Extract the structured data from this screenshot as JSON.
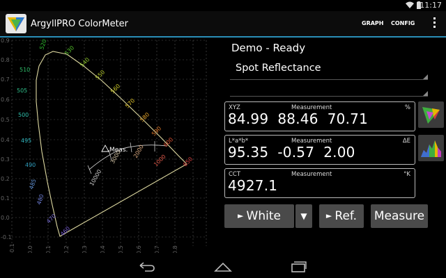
{
  "status_bar": {
    "time": "11:17"
  },
  "action_bar": {
    "title": "ArgyllPRO ColorMeter",
    "graph_label": "GRAPH",
    "config_label": "CONFIG"
  },
  "chart": {
    "x_ticks": [
      "-0.1",
      "0.0",
      "0.1",
      "0.2",
      "0.3",
      "0.4",
      "0.5",
      "0.6",
      "0.7",
      "0.8"
    ],
    "y_ticks": [
      "0.9",
      "0.8",
      "0.7",
      "0.6",
      "0.5",
      "0.4",
      "0.3",
      "0.2",
      "0.1",
      "0.0",
      "-0.1"
    ],
    "wavelength_labels": [
      "520",
      "530",
      "540",
      "550",
      "560",
      "570",
      "580",
      "590",
      "600",
      "650",
      "510",
      "505",
      "500",
      "495",
      "490",
      "485",
      "480",
      "470",
      "460"
    ],
    "cct_labels": [
      "10000",
      "3000",
      "2000",
      "1000"
    ],
    "marker_label": "Meas."
  },
  "status": "Demo - Ready",
  "mode": "Spot Reflectance",
  "xyz": {
    "label": "XYZ",
    "measurement": "Measurement",
    "unit": "%",
    "values": "84.99  88.46  70.71"
  },
  "lab": {
    "label": "L*a*b*",
    "measurement": "Measurement",
    "unit": "ΔE",
    "values": "95.35  -0.57  2.00"
  },
  "cct": {
    "label": "CCT",
    "measurement": "Measurement",
    "unit": "°K",
    "values": "4927.1"
  },
  "buttons": {
    "white": "White",
    "ref": "Ref.",
    "measure": "Measure"
  },
  "colors": {
    "accent": "#2a8fb8",
    "locus": "#ddd8a0"
  }
}
